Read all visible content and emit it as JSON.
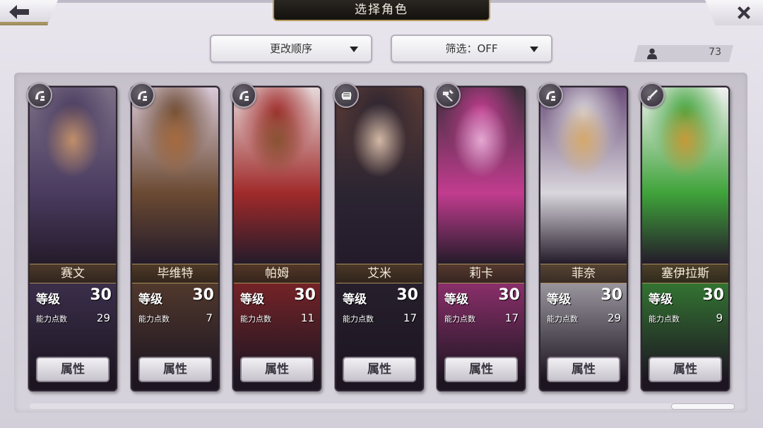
{
  "header": {
    "title": "选择角色",
    "back_icon": "back-arrow-icon",
    "close_icon": "close-icon"
  },
  "controls": {
    "sort_label": "更改顺序",
    "filter_label": "筛选：OFF",
    "character_count": "73"
  },
  "labels": {
    "level": "等级",
    "ability_points": "能力点数",
    "attributes_button": "属性"
  },
  "characters": [
    {
      "name": "赛文",
      "level": "30",
      "points": "29",
      "type_icon": "claw-weapon-icon",
      "palette": [
        "#4a3b5f",
        "#7b6f86",
        "#c08f6a"
      ]
    },
    {
      "name": "毕维特",
      "level": "30",
      "points": "7",
      "type_icon": "claw-weapon-icon",
      "palette": [
        "#6b4a32",
        "#d9c9d8",
        "#a56a3f"
      ]
    },
    {
      "name": "帕姆",
      "level": "30",
      "points": "11",
      "type_icon": "claw-weapon-icon",
      "palette": [
        "#a02a2a",
        "#e6d9da",
        "#8a5334"
      ]
    },
    {
      "name": "艾米",
      "level": "30",
      "points": "17",
      "type_icon": "fist-icon",
      "palette": [
        "#2b2431",
        "#5a3b35",
        "#d3b8a5"
      ]
    },
    {
      "name": "莉卡",
      "level": "30",
      "points": "17",
      "type_icon": "hammer-icon",
      "palette": [
        "#c23c8f",
        "#3c2f3b",
        "#e3a8d2"
      ]
    },
    {
      "name": "菲奈",
      "level": "30",
      "points": "29",
      "type_icon": "claw-weapon-icon",
      "palette": [
        "#d9d6dc",
        "#6b4e7a",
        "#d4a86b"
      ]
    },
    {
      "name": "塞伊拉斯",
      "level": "30",
      "points": "9",
      "type_icon": "sword-icon",
      "palette": [
        "#3fa33a",
        "#f1f1f1",
        "#c69a3a"
      ]
    }
  ],
  "colors": {
    "title_plate": "#1a1612",
    "gold_trim": "#b79b5b",
    "card_frame": "#2d2630"
  }
}
